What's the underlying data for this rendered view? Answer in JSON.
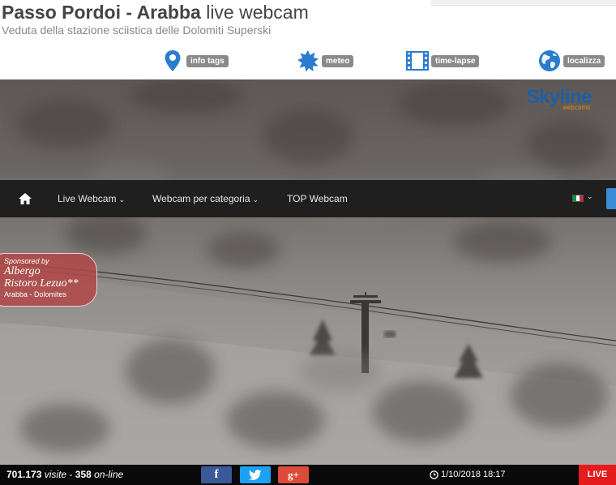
{
  "header": {
    "title_bold": "Passo Pordoi - Arabba",
    "title_light": "live webcam",
    "subtitle": "Veduta della stazione sciistica delle Dolomiti Superski",
    "actions": [
      {
        "label": "info tags",
        "icon": "map-marker-icon"
      },
      {
        "label": "meteo",
        "icon": "sun-icon"
      },
      {
        "label": "time-lapse",
        "icon": "film-icon"
      },
      {
        "label": "localizza",
        "icon": "globe-icon"
      }
    ]
  },
  "logo": {
    "name": "Skyline",
    "sub": "webcams"
  },
  "nav": {
    "items": [
      {
        "label": "Live Webcam",
        "has_dropdown": true
      },
      {
        "label": "Webcam per categoria",
        "has_dropdown": true
      },
      {
        "label": "TOP Webcam",
        "has_dropdown": false
      }
    ],
    "language_flag": "italy-flag-icon"
  },
  "sponsor": {
    "line1": "Sponsored by",
    "line2": "Albergo",
    "line3": "Ristoro Lezuo**",
    "line4": "Arabba - Dolomites"
  },
  "footer": {
    "visits_count": "701.173",
    "visits_label": "visite",
    "separator": "-",
    "online_count": "358",
    "online_label": "on-line",
    "social": [
      "f",
      "twitter",
      "g+"
    ],
    "datetime": "1/10/2018 18:17",
    "live_label": "LIVE"
  },
  "colors": {
    "nav_bg": "#1f1f1f",
    "action_label_bg": "#8a8a8a",
    "icon_blue": "#2b7ccf",
    "live_red": "#e61b1b",
    "facebook": "#3b5998",
    "twitter": "#1da1f2",
    "googleplus": "#dd4b39",
    "sponsor_bg": "#b24646"
  }
}
